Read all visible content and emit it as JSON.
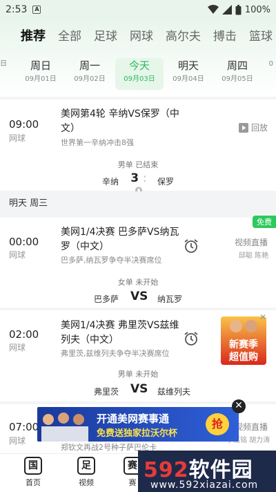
{
  "status_bar": {
    "time": "2:53",
    "sim_label": "A",
    "battery": "100%"
  },
  "category_tabs": [
    {
      "label": "推荐"
    },
    {
      "label": "全部"
    },
    {
      "label": "足球"
    },
    {
      "label": "网球"
    },
    {
      "label": "高尔夫"
    },
    {
      "label": "搏击"
    },
    {
      "label": "篮球"
    }
  ],
  "date_strip": [
    {
      "weekday": "",
      "date": "日"
    },
    {
      "weekday": "周日",
      "date": "09月01日"
    },
    {
      "weekday": "周一",
      "date": "09月02日"
    },
    {
      "weekday": "今天",
      "date": "09月03日"
    },
    {
      "weekday": "明天",
      "date": "09月04日"
    },
    {
      "weekday": "周四",
      "date": "09月05日"
    },
    {
      "weekday": "",
      "date": "0"
    }
  ],
  "matches": [
    {
      "time": "09:00",
      "sport": "网球",
      "title": "美网第4轮 辛纳VS保罗（中文）",
      "subtitle": "世界第一辛纳冲击8强",
      "category": "男单 已结束",
      "home": "辛纳",
      "away": "保罗",
      "score_home": "3",
      "score_sep": ":",
      "score_away": "0",
      "action": "回放"
    },
    {
      "time": "00:00",
      "sport": "网球",
      "title": "美网1/4决赛 巴多萨VS纳瓦罗（中文）",
      "subtitle": "巴多萨,纳瓦罗争夺半决赛席位",
      "category": "女单 未开始",
      "home": "巴多萨",
      "vs": "VS",
      "away": "纳瓦罗",
      "badge": "免费",
      "live_label": "视频直播",
      "commentators": "邱聪 陈艳"
    },
    {
      "time": "02:00",
      "sport": "网球",
      "title": "美网1/4决赛 弗里茨VS兹维列夫（中文）",
      "subtitle": "弗里茨,兹维列夫争夺半决赛席位",
      "category": "男单 未开始",
      "home": "弗里茨",
      "vs": "VS",
      "away": "兹维列夫"
    },
    {
      "time": "07:00",
      "sport": "网球",
      "subtitle": "郑钦文再战2号种子萨巴伦卡",
      "live_label": "视频直播",
      "commentators": "李嘉铭 胡力涛"
    }
  ],
  "section_header": "明天 周三",
  "side_ad": {
    "line1": "新赛季",
    "line2": "超值购"
  },
  "ad_banner": {
    "line1": "开通美网赛事通",
    "line2": "免费送独家拉沃尔杯",
    "cta": "抢"
  },
  "bottom_nav": [
    {
      "icon_char": "国",
      "label": "首页"
    },
    {
      "icon_char": "足",
      "label": "视频"
    },
    {
      "icon_char": "赛",
      "label": "赛"
    }
  ],
  "watermark": {
    "brand_num": "592",
    "brand_text": "软件园",
    "url": "www.592xiazai.com"
  },
  "colors": {
    "accent": "#2ec95c",
    "accent_dark": "#2eb860"
  }
}
